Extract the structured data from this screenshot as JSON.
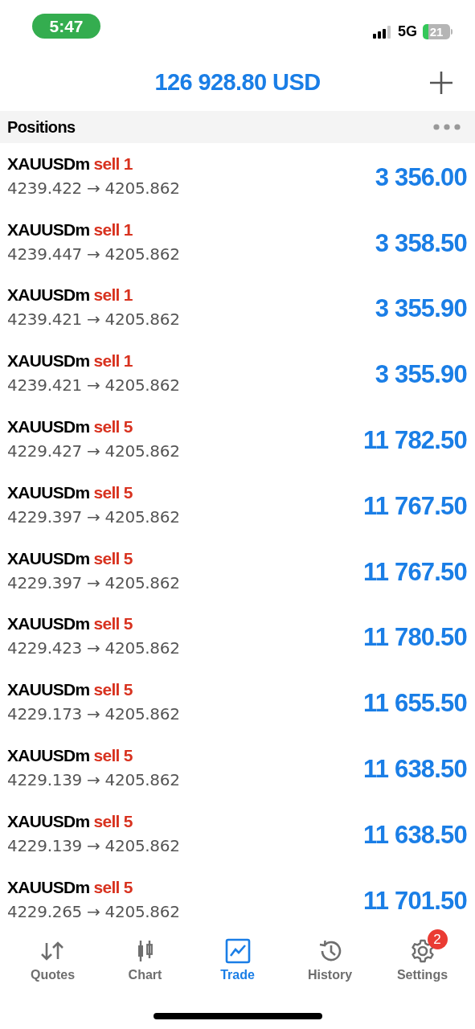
{
  "status_bar": {
    "time": "5:47",
    "network": "5G",
    "battery": "21"
  },
  "header": {
    "balance": "126 928.80 USD"
  },
  "section": {
    "title": "Positions"
  },
  "positions": [
    {
      "symbol": "XAUUSDm",
      "side": "sell 1",
      "prices": "4239.422 → 4205.862",
      "profit": "3 356.00"
    },
    {
      "symbol": "XAUUSDm",
      "side": "sell 1",
      "prices": "4239.447 → 4205.862",
      "profit": "3 358.50"
    },
    {
      "symbol": "XAUUSDm",
      "side": "sell 1",
      "prices": "4239.421 → 4205.862",
      "profit": "3 355.90"
    },
    {
      "symbol": "XAUUSDm",
      "side": "sell 1",
      "prices": "4239.421 → 4205.862",
      "profit": "3 355.90"
    },
    {
      "symbol": "XAUUSDm",
      "side": "sell 5",
      "prices": "4229.427 → 4205.862",
      "profit": "11 782.50"
    },
    {
      "symbol": "XAUUSDm",
      "side": "sell 5",
      "prices": "4229.397 → 4205.862",
      "profit": "11 767.50"
    },
    {
      "symbol": "XAUUSDm",
      "side": "sell 5",
      "prices": "4229.397 → 4205.862",
      "profit": "11 767.50"
    },
    {
      "symbol": "XAUUSDm",
      "side": "sell 5",
      "prices": "4229.423 → 4205.862",
      "profit": "11 780.50"
    },
    {
      "symbol": "XAUUSDm",
      "side": "sell 5",
      "prices": "4229.173 → 4205.862",
      "profit": "11 655.50"
    },
    {
      "symbol": "XAUUSDm",
      "side": "sell 5",
      "prices": "4229.139 → 4205.862",
      "profit": "11 638.50"
    },
    {
      "symbol": "XAUUSDm",
      "side": "sell 5",
      "prices": "4229.139 → 4205.862",
      "profit": "11 638.50"
    },
    {
      "symbol": "XAUUSDm",
      "side": "sell 5",
      "prices": "4229.265 → 4205.862",
      "profit": "11 701.50"
    }
  ],
  "tabs": [
    {
      "label": "Quotes",
      "selected": false
    },
    {
      "label": "Chart",
      "selected": false
    },
    {
      "label": "Trade",
      "selected": true
    },
    {
      "label": "History",
      "selected": false
    },
    {
      "label": "Settings",
      "selected": false,
      "badge": "2"
    }
  ]
}
